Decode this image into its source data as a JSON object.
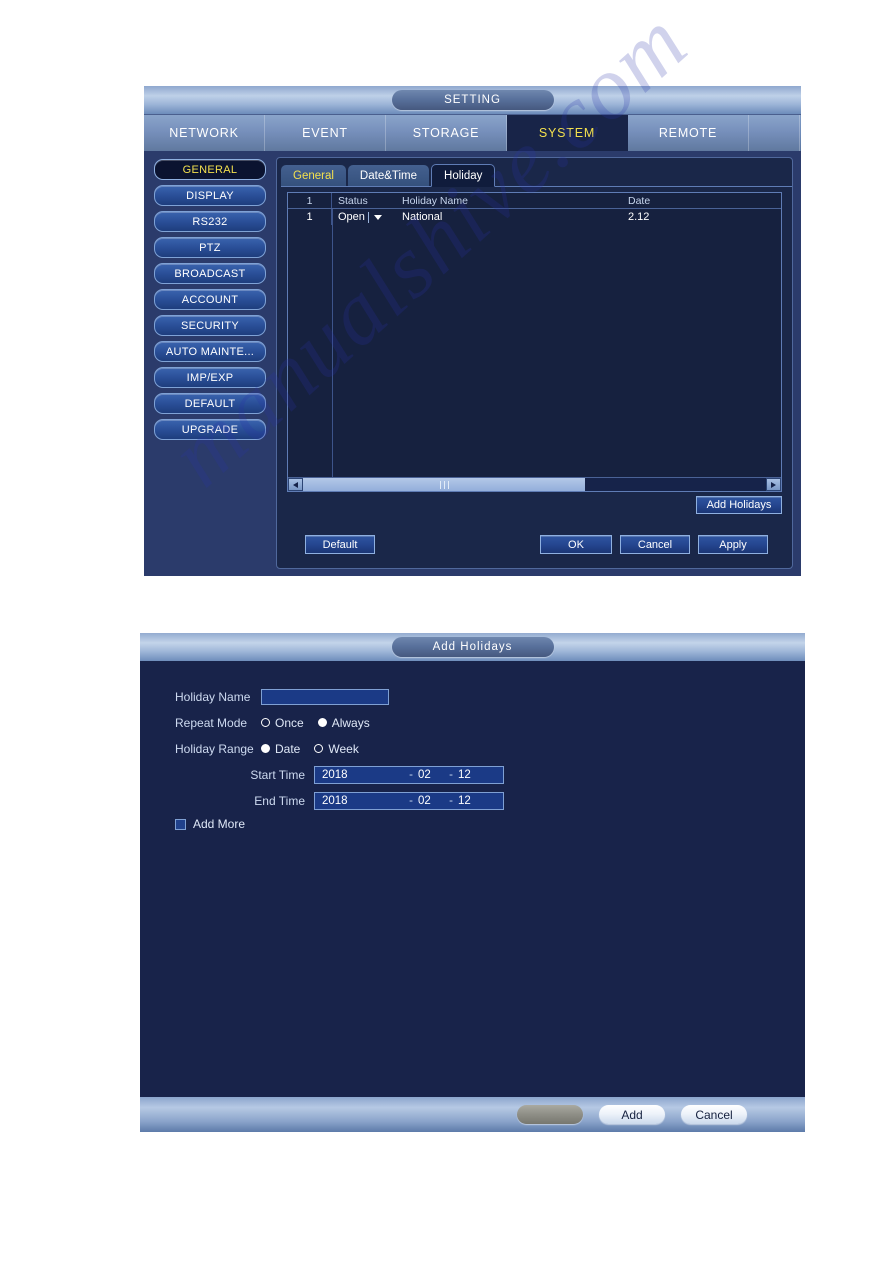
{
  "watermark": "manualshive.com",
  "setting_window": {
    "title": "SETTING",
    "top_tabs": [
      {
        "label": "NETWORK",
        "active": false
      },
      {
        "label": "EVENT",
        "active": false
      },
      {
        "label": "STORAGE",
        "active": false
      },
      {
        "label": "SYSTEM",
        "active": true
      },
      {
        "label": "REMOTE",
        "active": false
      }
    ],
    "side_menu": [
      {
        "label": "GENERAL",
        "active": true
      },
      {
        "label": "DISPLAY",
        "active": false
      },
      {
        "label": "RS232",
        "active": false
      },
      {
        "label": "PTZ",
        "active": false
      },
      {
        "label": "BROADCAST",
        "active": false
      },
      {
        "label": "ACCOUNT",
        "active": false
      },
      {
        "label": "SECURITY",
        "active": false
      },
      {
        "label": "AUTO MAINTE...",
        "active": false
      },
      {
        "label": "IMP/EXP",
        "active": false
      },
      {
        "label": "DEFAULT",
        "active": false
      },
      {
        "label": "UPGRADE",
        "active": false
      }
    ],
    "sub_tabs": [
      {
        "label": "General",
        "state": "hover"
      },
      {
        "label": "Date&Time",
        "state": "normal"
      },
      {
        "label": "Holiday",
        "state": "active"
      }
    ],
    "table": {
      "headers": {
        "index": "1",
        "status": "Status",
        "name": "Holiday Name",
        "date": "Date"
      },
      "rows": [
        {
          "index": "1",
          "status": "Open",
          "name": "National",
          "date": "2.12"
        }
      ]
    },
    "scrollbar": {
      "left_arrow": "left-arrow-icon",
      "right_arrow": "right-arrow-icon",
      "thumb_percent": 61
    },
    "buttons": {
      "add_holidays": "Add Holidays",
      "default": "Default",
      "ok": "OK",
      "cancel": "Cancel",
      "apply": "Apply"
    }
  },
  "add_holidays_dialog": {
    "title": "Add Holidays",
    "fields": {
      "holiday_name_label": "Holiday Name",
      "holiday_name_value": "",
      "repeat_mode_label": "Repeat Mode",
      "repeat_mode_options": [
        {
          "label": "Once",
          "selected": false
        },
        {
          "label": "Always",
          "selected": true
        }
      ],
      "holiday_range_label": "Holiday Range",
      "holiday_range_options": [
        {
          "label": "Date",
          "selected": true
        },
        {
          "label": "Week",
          "selected": false
        }
      ],
      "start_time_label": "Start Time",
      "start_time": {
        "year": "2018",
        "month": "02",
        "day": "12",
        "separator": "-"
      },
      "end_time_label": "End Time",
      "end_time": {
        "year": "2018",
        "month": "02",
        "day": "12",
        "separator": "-"
      },
      "add_more_label": "Add More",
      "add_more_checked": false
    },
    "footer_buttons": {
      "disabled": "",
      "add": "Add",
      "cancel": "Cancel"
    }
  },
  "colors": {
    "accent_yellow": "#f3e04e",
    "panel_bg": "#2b3b6b",
    "content_bg": "#1a2749",
    "dialog_bg": "#18234a",
    "button_blue": "#254690",
    "border_light": "#8fb0e0"
  }
}
